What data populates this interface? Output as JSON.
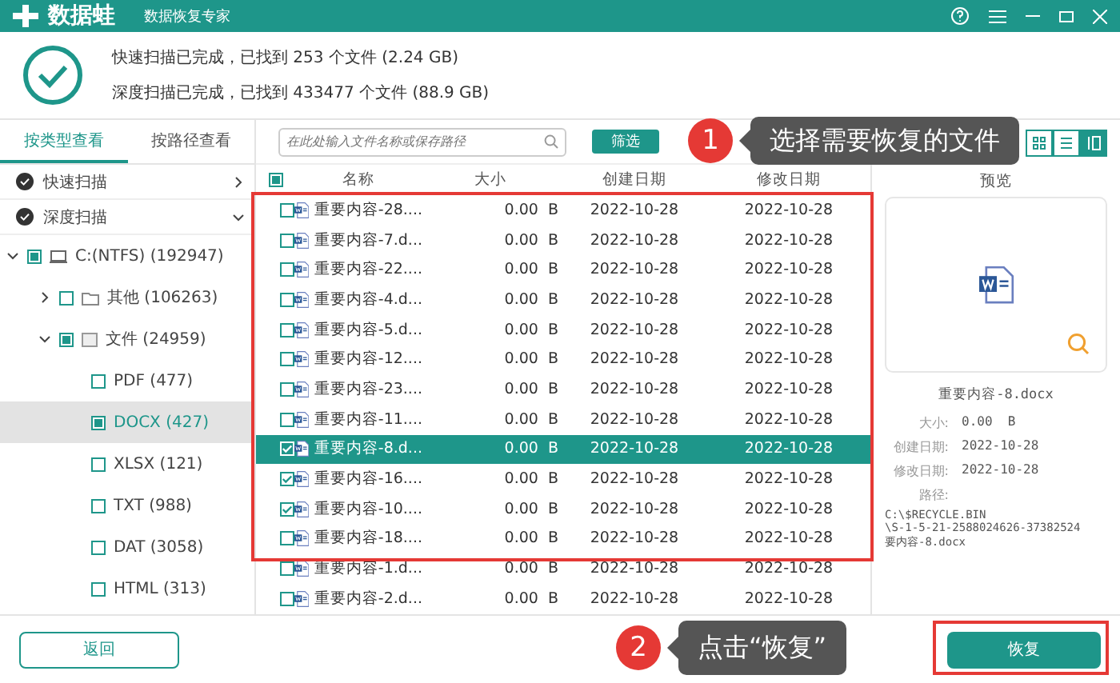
{
  "titlebar": {
    "logo": "数据蛙",
    "subtitle": "数据恢复专家"
  },
  "scan_summary": [
    "快速扫描已完成，已找到 253 个文件 (2.24 GB)",
    "深度扫描已完成，已找到 433477 个文件 (88.9 GB)"
  ],
  "view_tabs": [
    {
      "label": "按类型查看",
      "selected": true
    },
    {
      "label": "按路径查看",
      "selected": false
    }
  ],
  "search": {
    "placeholder": "在此处输入文件名称或保存路径"
  },
  "filter_button": "筛选",
  "layout_toggles": [
    {
      "selected": false
    },
    {
      "selected": false
    },
    {
      "selected": true
    }
  ],
  "sidebar": {
    "scans": [
      {
        "label": "快速扫描",
        "expanded": false
      },
      {
        "label": "深度扫描",
        "expanded": true
      }
    ],
    "tree": [
      {
        "label": "C:(NTFS) (192947)",
        "kind": "drive",
        "checked": true,
        "expanded": true,
        "selected": false,
        "children": [
          {
            "label": "其他 (106263)",
            "kind": "folder",
            "checked": false,
            "expanded": false,
            "selected": false
          },
          {
            "label": "文件 (24959)",
            "kind": "category",
            "checked": true,
            "expanded": true,
            "selected": false,
            "children": [
              {
                "label": "PDF (477)",
                "checked": false,
                "selected": false
              },
              {
                "label": "DOCX (427)",
                "checked": true,
                "selected": true
              },
              {
                "label": "XLSX (121)",
                "checked": false,
                "selected": false
              },
              {
                "label": "TXT (988)",
                "checked": false,
                "selected": false
              },
              {
                "label": "DAT (3058)",
                "checked": false,
                "selected": false
              },
              {
                "label": "HTML (313)",
                "checked": false,
                "selected": false
              }
            ]
          }
        ]
      }
    ]
  },
  "table": {
    "all_checked": true,
    "columns": [
      "名称",
      "大小",
      "创建日期",
      "修改日期"
    ],
    "rows": [
      {
        "name": "重要内容-28....",
        "size": "0.00  B",
        "created": "2022-10-28",
        "modified": "2022-10-28",
        "checked": false,
        "selected": false
      },
      {
        "name": "重要内容-7.d...",
        "size": "0.00  B",
        "created": "2022-10-28",
        "modified": "2022-10-28",
        "checked": false,
        "selected": false
      },
      {
        "name": "重要内容-22....",
        "size": "0.00  B",
        "created": "2022-10-28",
        "modified": "2022-10-28",
        "checked": false,
        "selected": false
      },
      {
        "name": "重要内容-4.d...",
        "size": "0.00  B",
        "created": "2022-10-28",
        "modified": "2022-10-28",
        "checked": false,
        "selected": false
      },
      {
        "name": "重要内容-5.d...",
        "size": "0.00  B",
        "created": "2022-10-28",
        "modified": "2022-10-28",
        "checked": false,
        "selected": false
      },
      {
        "name": "重要内容-12....",
        "size": "0.00  B",
        "created": "2022-10-28",
        "modified": "2022-10-28",
        "checked": false,
        "selected": false
      },
      {
        "name": "重要内容-23....",
        "size": "0.00  B",
        "created": "2022-10-28",
        "modified": "2022-10-28",
        "checked": false,
        "selected": false
      },
      {
        "name": "重要内容-11....",
        "size": "0.00  B",
        "created": "2022-10-28",
        "modified": "2022-10-28",
        "checked": false,
        "selected": false
      },
      {
        "name": "重要内容-8.d...",
        "size": "0.00  B",
        "created": "2022-10-28",
        "modified": "2022-10-28",
        "checked": true,
        "selected": true
      },
      {
        "name": "重要内容-16....",
        "size": "0.00  B",
        "created": "2022-10-28",
        "modified": "2022-10-28",
        "checked": true,
        "selected": false
      },
      {
        "name": "重要内容-10....",
        "size": "0.00  B",
        "created": "2022-10-28",
        "modified": "2022-10-28",
        "checked": true,
        "selected": false
      },
      {
        "name": "重要内容-18....",
        "size": "0.00  B",
        "created": "2022-10-28",
        "modified": "2022-10-28",
        "checked": false,
        "selected": false
      },
      {
        "name": "重要内容-1.d...",
        "size": "0.00  B",
        "created": "2022-10-28",
        "modified": "2022-10-28",
        "checked": false,
        "selected": false
      },
      {
        "name": "重要内容-2.d...",
        "size": "0.00  B",
        "created": "2022-10-28",
        "modified": "2022-10-28",
        "checked": false,
        "selected": false
      }
    ]
  },
  "preview": {
    "heading": "预览",
    "file_name": "重要内容-8.docx",
    "details": [
      {
        "label": "大小:",
        "value": "0.00  B"
      },
      {
        "label": "创建日期:",
        "value": "2022-10-28"
      },
      {
        "label": "修改日期:",
        "value": "2022-10-28"
      }
    ],
    "path_label": "路径:",
    "path_lines": [
      "C:\\$RECYCLE.BIN",
      "\\S-1-5-21-2588024626-37382524",
      "要内容-8.docx"
    ]
  },
  "back_button": "返回",
  "recover_button": "恢复",
  "callouts": [
    {
      "number": "1",
      "text": "选择需要恢复的文件"
    },
    {
      "number": "2",
      "text": "点击“恢复”"
    }
  ]
}
